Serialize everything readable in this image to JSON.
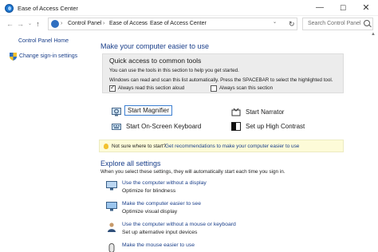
{
  "window": {
    "title": "Ease of Access Center",
    "minimize": "—",
    "maximize": "☐",
    "close": "✕"
  },
  "nav": {
    "back": "←",
    "forward": "→",
    "recent": "⌄",
    "up": "↑",
    "refresh": "↻",
    "dropdown": "⌄"
  },
  "breadcrumb": {
    "items": [
      "Control Panel",
      "Ease of Access",
      "Ease of Access Center"
    ],
    "separator": "›"
  },
  "search": {
    "placeholder": "Search Control Panel"
  },
  "sidebar": {
    "home": "Control Panel Home",
    "change_signin": "Change sign-in settings"
  },
  "main": {
    "title": "Make your computer easier to use",
    "quick": {
      "title": "Quick access to common tools",
      "line1": "You can use the tools in this section to help you get started.",
      "line2": "Windows can read and scan this list automatically.  Press the SPACEBAR to select the highlighted tool.",
      "check_read": "Always read this section aloud",
      "check_read_checked": true,
      "check_scan": "Always scan this section",
      "check_scan_checked": false
    },
    "tools": [
      {
        "label": "Start Magnifier",
        "icon": "magnifier-icon"
      },
      {
        "label": "Start Narrator",
        "icon": "narrator-icon"
      },
      {
        "label": "Start On-Screen Keyboard",
        "icon": "keyboard-icon"
      },
      {
        "label": "Set up High Contrast",
        "icon": "high-contrast-icon"
      }
    ],
    "hint": {
      "question": "Not sure where to start?",
      "link": "Get recommendations to make your computer easier to use"
    },
    "explore": {
      "title": "Explore all settings",
      "subtitle": "When you select these settings, they will automatically start each time you sign in.",
      "items": [
        {
          "link": "Use the computer without a display",
          "sub": "Optimize for blindness",
          "icon": "display-off-icon"
        },
        {
          "link": "Make the computer easier to see",
          "sub": "Optimize visual display",
          "icon": "display-icon"
        },
        {
          "link": "Use the computer without a mouse or keyboard",
          "sub": "Set up alternative input devices",
          "icon": "person-icon"
        },
        {
          "link": "Make the mouse easier to use",
          "sub": "",
          "icon": "mouse-icon"
        }
      ]
    }
  },
  "colors": {
    "link": "#1a3f8a",
    "quick_bg": "#ececec",
    "hint_bg": "#fdfbd8",
    "focus": "#3c7fd1"
  }
}
